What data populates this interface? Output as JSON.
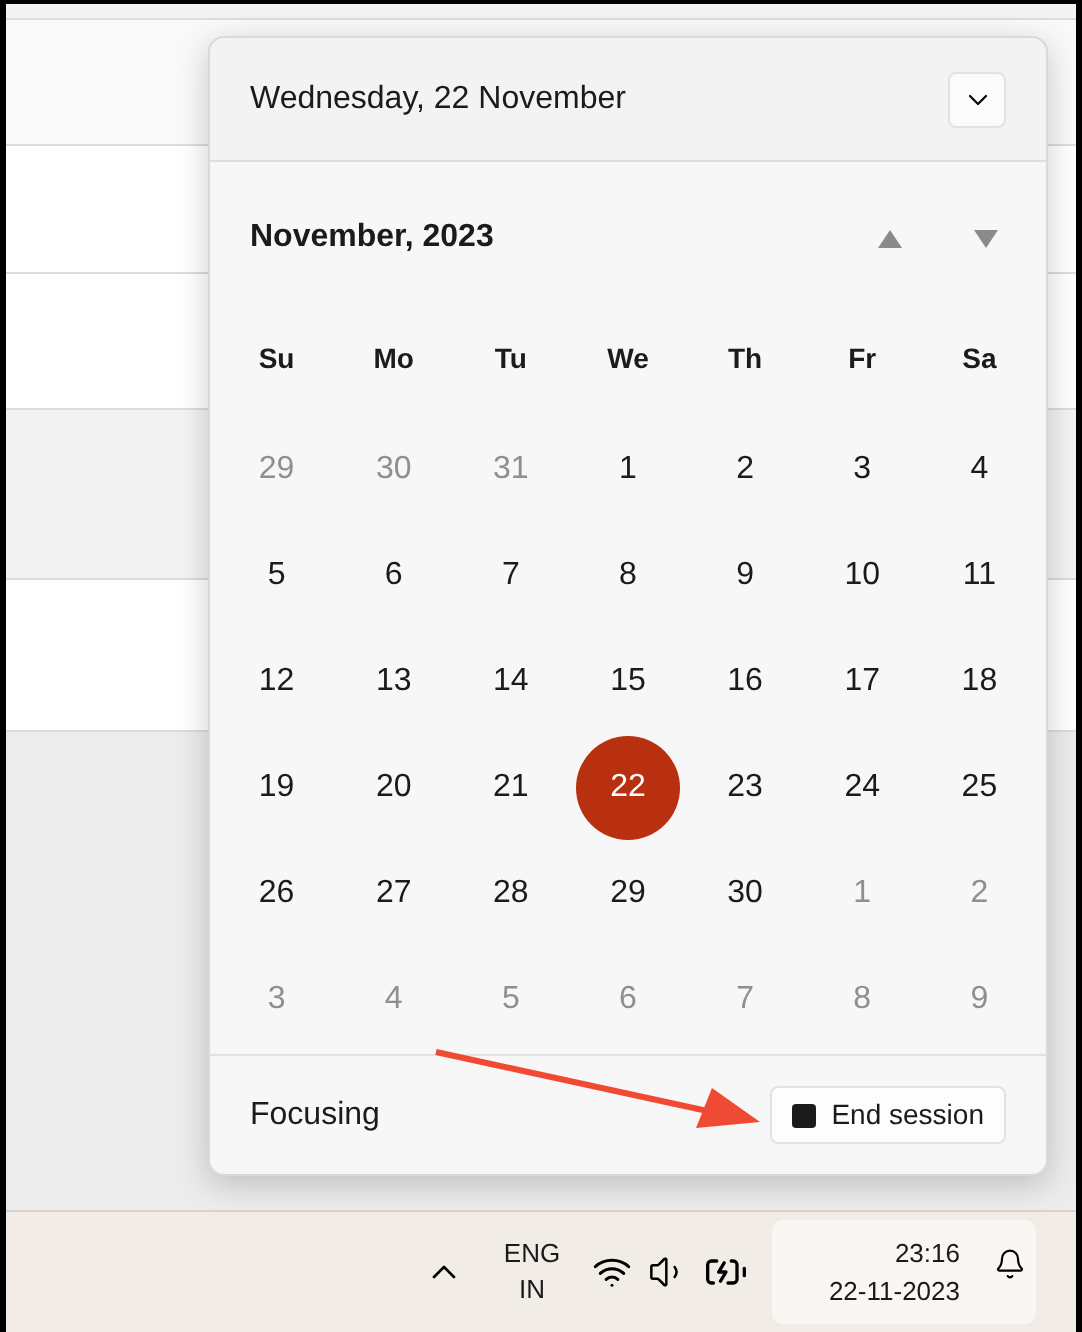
{
  "flyout": {
    "date_heading": "Wednesday, 22 November",
    "month_title": "November, 2023",
    "weekdays": [
      "Su",
      "Mo",
      "Tu",
      "We",
      "Th",
      "Fr",
      "Sa"
    ],
    "days": [
      {
        "label": "29",
        "muted": true,
        "selected": false
      },
      {
        "label": "30",
        "muted": true,
        "selected": false
      },
      {
        "label": "31",
        "muted": true,
        "selected": false
      },
      {
        "label": "1",
        "muted": false,
        "selected": false
      },
      {
        "label": "2",
        "muted": false,
        "selected": false
      },
      {
        "label": "3",
        "muted": false,
        "selected": false
      },
      {
        "label": "4",
        "muted": false,
        "selected": false
      },
      {
        "label": "5",
        "muted": false,
        "selected": false
      },
      {
        "label": "6",
        "muted": false,
        "selected": false
      },
      {
        "label": "7",
        "muted": false,
        "selected": false
      },
      {
        "label": "8",
        "muted": false,
        "selected": false
      },
      {
        "label": "9",
        "muted": false,
        "selected": false
      },
      {
        "label": "10",
        "muted": false,
        "selected": false
      },
      {
        "label": "11",
        "muted": false,
        "selected": false
      },
      {
        "label": "12",
        "muted": false,
        "selected": false
      },
      {
        "label": "13",
        "muted": false,
        "selected": false
      },
      {
        "label": "14",
        "muted": false,
        "selected": false
      },
      {
        "label": "15",
        "muted": false,
        "selected": false
      },
      {
        "label": "16",
        "muted": false,
        "selected": false
      },
      {
        "label": "17",
        "muted": false,
        "selected": false
      },
      {
        "label": "18",
        "muted": false,
        "selected": false
      },
      {
        "label": "19",
        "muted": false,
        "selected": false
      },
      {
        "label": "20",
        "muted": false,
        "selected": false
      },
      {
        "label": "21",
        "muted": false,
        "selected": false
      },
      {
        "label": "22",
        "muted": false,
        "selected": true
      },
      {
        "label": "23",
        "muted": false,
        "selected": false
      },
      {
        "label": "24",
        "muted": false,
        "selected": false
      },
      {
        "label": "25",
        "muted": false,
        "selected": false
      },
      {
        "label": "26",
        "muted": false,
        "selected": false
      },
      {
        "label": "27",
        "muted": false,
        "selected": false
      },
      {
        "label": "28",
        "muted": false,
        "selected": false
      },
      {
        "label": "29",
        "muted": false,
        "selected": false
      },
      {
        "label": "30",
        "muted": false,
        "selected": false
      },
      {
        "label": "1",
        "muted": true,
        "selected": false
      },
      {
        "label": "2",
        "muted": true,
        "selected": false
      },
      {
        "label": "3",
        "muted": true,
        "selected": false
      },
      {
        "label": "4",
        "muted": true,
        "selected": false
      },
      {
        "label": "5",
        "muted": true,
        "selected": false
      },
      {
        "label": "6",
        "muted": true,
        "selected": false
      },
      {
        "label": "7",
        "muted": true,
        "selected": false
      },
      {
        "label": "8",
        "muted": true,
        "selected": false
      },
      {
        "label": "9",
        "muted": true,
        "selected": false
      }
    ],
    "focus_label": "Focusing",
    "end_session_button": "End session"
  },
  "taskbar": {
    "language": "ENG",
    "region": "IN",
    "time": "23:16",
    "date": "22-11-2023"
  }
}
